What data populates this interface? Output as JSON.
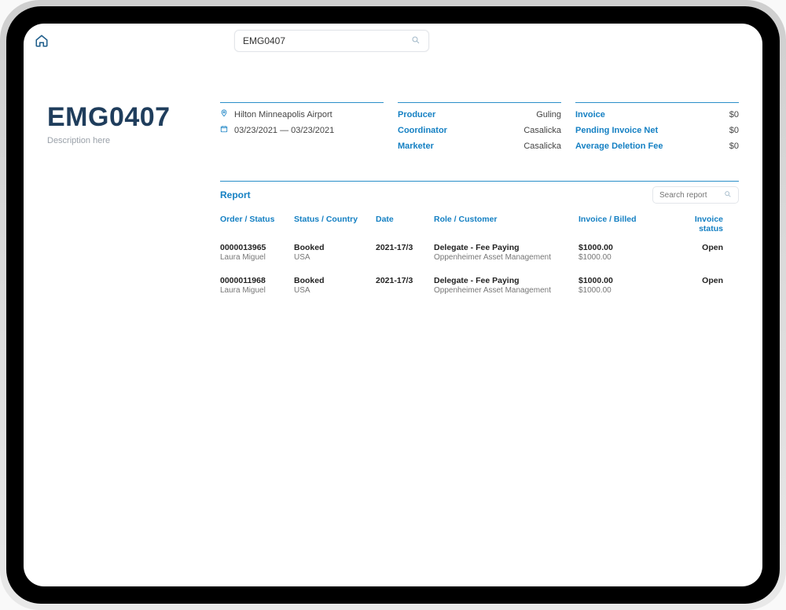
{
  "search": {
    "value": "EMG0407"
  },
  "page": {
    "title": "EMG0407",
    "description": "Description here"
  },
  "location": {
    "venue": "Hilton Minneapolis Airport",
    "dates": "03/23/2021 — 03/23/2021"
  },
  "team": {
    "producer": {
      "label": "Producer",
      "value": "Guling"
    },
    "coordinator": {
      "label": "Coordinator",
      "value": "Casalicka"
    },
    "marketer": {
      "label": "Marketer",
      "value": "Casalicka"
    }
  },
  "finance": {
    "invoice": {
      "label": "Invoice",
      "value": "$0"
    },
    "pending": {
      "label": "Pending Invoice Net",
      "value": "$0"
    },
    "avgdel": {
      "label": "Average Deletion Fee",
      "value": "$0"
    }
  },
  "report": {
    "title": "Report",
    "search_placeholder": "Search report",
    "columns": {
      "order": "Order / Status",
      "status": "Status / Country",
      "date": "Date",
      "role": "Role / Customer",
      "invoice": "Invoice / Billed",
      "invstatus": "Invoice status"
    },
    "rows": [
      {
        "order": "0000013965",
        "name": "Laura Miguel",
        "status": "Booked",
        "country": "USA",
        "date": "2021-17/3",
        "role": "Delegate - Fee Paying",
        "customer": "Oppenheimer Asset Management",
        "invoice": "$1000.00",
        "billed": "$1000.00",
        "invstatus": "Open"
      },
      {
        "order": "0000011968",
        "name": "Laura Miguel",
        "status": "Booked",
        "country": "USA",
        "date": "2021-17/3",
        "role": "Delegate - Fee Paying",
        "customer": "Oppenheimer Asset Management",
        "invoice": "$1000.00",
        "billed": "$1000.00",
        "invstatus": "Open"
      }
    ]
  }
}
